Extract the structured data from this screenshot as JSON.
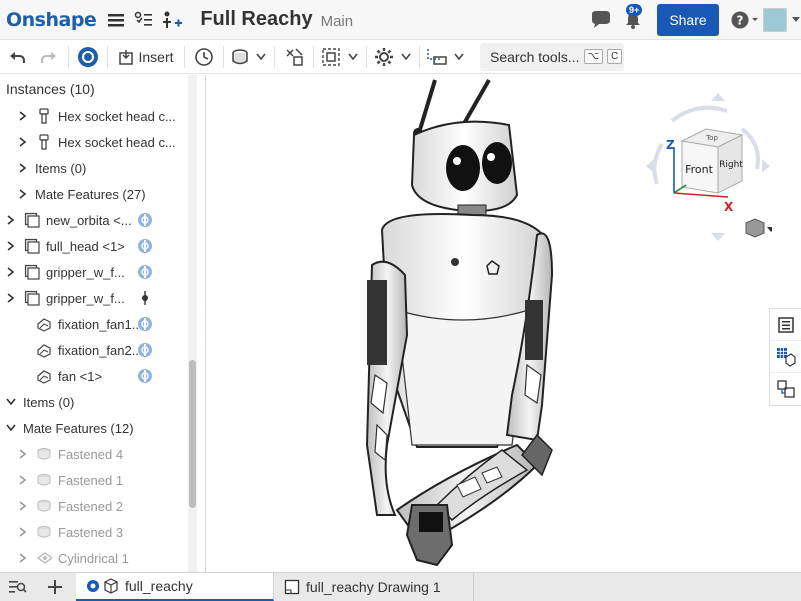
{
  "header": {
    "logo": "Onshape",
    "doc_title": "Full Reachy",
    "branch": "Main",
    "notifications_badge": "9+",
    "share_label": "Share",
    "help_label": "?"
  },
  "toolbar": {
    "insert_label": "Insert",
    "search_placeholder": "Search tools...",
    "search_shortcut_1": "⌥",
    "search_shortcut_2": "C"
  },
  "panel": {
    "instances_heading": "Instances (10)",
    "rows": [
      {
        "label": "Hex socket head c...",
        "indent": 1,
        "icon": "part",
        "dim": false
      },
      {
        "label": "Hex socket head c...",
        "indent": 1,
        "icon": "part",
        "dim": false
      },
      {
        "label": "Items (0)",
        "indent": 1,
        "icon": "none",
        "dim": false
      },
      {
        "label": "Mate Features (27)",
        "indent": 1,
        "icon": "none",
        "dim": false
      },
      {
        "label": "new_orbita <...",
        "indent": 0,
        "icon": "assembly",
        "dim": false,
        "link": true
      },
      {
        "label": "full_head <1>",
        "indent": 0,
        "icon": "assembly",
        "dim": false,
        "link": true
      },
      {
        "label": "gripper_w_f...",
        "indent": 0,
        "icon": "assembly",
        "dim": false,
        "link": true
      },
      {
        "label": "gripper_w_f...",
        "indent": 0,
        "icon": "assembly",
        "dim": false,
        "link_dot": true
      },
      {
        "label": "fixation_fan1...",
        "indent": 1,
        "icon": "partstudio",
        "dim": false,
        "link": true,
        "nochev": true
      },
      {
        "label": "fixation_fan2...",
        "indent": 1,
        "icon": "partstudio",
        "dim": false,
        "link": true,
        "nochev": true
      },
      {
        "label": "fan <1>",
        "indent": 1,
        "icon": "partstudio",
        "dim": false,
        "link": true,
        "nochev": true
      },
      {
        "label": "Items (0)",
        "indent": 0,
        "icon": "none",
        "dim": false,
        "open": true
      },
      {
        "label": "Mate Features (12)",
        "indent": 0,
        "icon": "none",
        "dim": false,
        "open": true
      },
      {
        "label": "Fastened 4",
        "indent": 1,
        "icon": "fastened",
        "dim": true
      },
      {
        "label": "Fastened 1",
        "indent": 1,
        "icon": "fastened",
        "dim": true
      },
      {
        "label": "Fastened 2",
        "indent": 1,
        "icon": "fastened",
        "dim": true
      },
      {
        "label": "Fastened 3",
        "indent": 1,
        "icon": "fastened",
        "dim": true
      },
      {
        "label": "Cylindrical 1",
        "indent": 1,
        "icon": "cylindrical",
        "dim": true
      }
    ]
  },
  "viewcube": {
    "axis_z": "Z",
    "axis_x": "X",
    "face_top": "Top",
    "face_front": "Front",
    "face_right": "Right"
  },
  "tabs": [
    {
      "label": "full_reachy",
      "active": true
    },
    {
      "label": "full_reachy Drawing 1",
      "active": false
    }
  ],
  "colors": {
    "brand": "#1d5fa8",
    "share": "#1a58b5"
  }
}
